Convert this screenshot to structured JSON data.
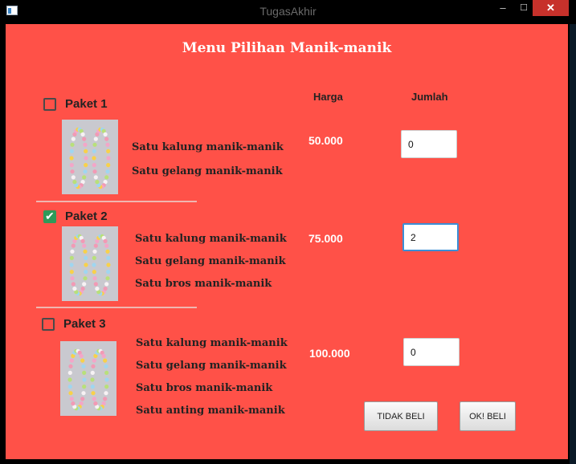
{
  "window": {
    "title": "TugasAkhir",
    "minimize_glyph": "–",
    "maximize_glyph": "☐",
    "close_glyph": "✕"
  },
  "heading": "Menu Pilihan Manik-manik",
  "columns": {
    "price": "Harga",
    "qty": "Jumlah"
  },
  "packages": [
    {
      "name": "Paket 1",
      "checked": false,
      "items": [
        "Satu kalung manik-manik",
        "Satu gelang manik-manik"
      ],
      "price": "50.000",
      "qty": "0"
    },
    {
      "name": "Paket 2",
      "checked": true,
      "items": [
        "Satu kalung manik-manik",
        "Satu gelang manik-manik",
        "Satu bros manik-manik"
      ],
      "price": "75.000",
      "qty": "2"
    },
    {
      "name": "Paket 3",
      "checked": false,
      "items": [
        "Satu kalung manik-manik",
        "Satu gelang manik-manik",
        "Satu bros manik-manik",
        "Satu anting manik-manik"
      ],
      "price": "100.000",
      "qty": "0"
    }
  ],
  "buttons": {
    "cancel": "TIDAK BELI",
    "ok": "OK! BELI"
  },
  "colors": {
    "background": "#ff5148",
    "check_green": "#2f9a59",
    "focus_blue": "#3b8ed6"
  }
}
